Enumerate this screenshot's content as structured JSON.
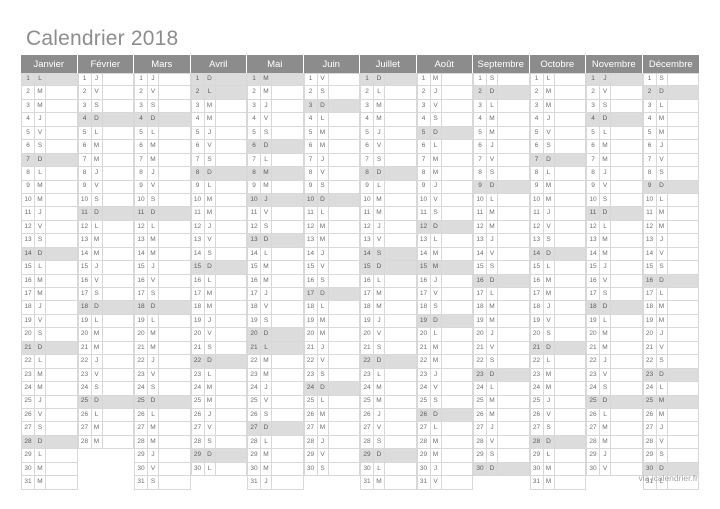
{
  "page": {
    "title": "Calendrier 2018",
    "footer": "via icalendrier.fr",
    "year": 2018,
    "language": "fr"
  },
  "colors": {
    "header_background": "#8c8c8c",
    "header_text": "#ffffff",
    "title_text": "#8d8d8d",
    "grid_line": "#d8d8d8",
    "cell_text": "#6f6f6f",
    "holiday_background": "#dcdcdc",
    "page_background": "#ffffff",
    "footer_text": "#a3a3a3"
  },
  "weekday_letters": {
    "L": "Lundi",
    "M": "Mardi/Mercredi",
    "J": "Jeudi",
    "V": "Vendredi",
    "S": "Samedi",
    "D": "Dimanche"
  },
  "months": [
    {
      "name": "Janvier",
      "index": 1,
      "num_days": 31,
      "start_letter": "L",
      "letters": [
        "L",
        "M",
        "M",
        "J",
        "V",
        "S",
        "D",
        "L",
        "M",
        "M",
        "J",
        "V",
        "S",
        "D",
        "L",
        "M",
        "M",
        "J",
        "V",
        "S",
        "D",
        "L",
        "M",
        "M",
        "J",
        "V",
        "S",
        "D",
        "L",
        "M",
        "M"
      ],
      "off_days": [
        1,
        7,
        14,
        21,
        28
      ]
    },
    {
      "name": "Février",
      "index": 2,
      "num_days": 28,
      "start_letter": "J",
      "letters": [
        "J",
        "V",
        "S",
        "D",
        "L",
        "M",
        "M",
        "J",
        "V",
        "S",
        "D",
        "L",
        "M",
        "M",
        "J",
        "V",
        "S",
        "D",
        "L",
        "M",
        "M",
        "J",
        "V",
        "S",
        "D",
        "L",
        "M",
        "M"
      ],
      "off_days": [
        4,
        11,
        18,
        25
      ]
    },
    {
      "name": "Mars",
      "index": 3,
      "num_days": 31,
      "start_letter": "J",
      "letters": [
        "J",
        "V",
        "S",
        "D",
        "L",
        "M",
        "M",
        "J",
        "V",
        "S",
        "D",
        "L",
        "M",
        "M",
        "J",
        "V",
        "S",
        "D",
        "L",
        "M",
        "M",
        "J",
        "V",
        "S",
        "D",
        "L",
        "M",
        "M",
        "J",
        "V",
        "S"
      ],
      "off_days": [
        4,
        11,
        18,
        25
      ]
    },
    {
      "name": "Avril",
      "index": 4,
      "num_days": 30,
      "start_letter": "D",
      "letters": [
        "D",
        "L",
        "M",
        "M",
        "J",
        "V",
        "S",
        "D",
        "L",
        "M",
        "M",
        "J",
        "V",
        "S",
        "D",
        "L",
        "M",
        "M",
        "J",
        "V",
        "S",
        "D",
        "L",
        "M",
        "M",
        "J",
        "V",
        "S",
        "D",
        "L"
      ],
      "off_days": [
        1,
        2,
        8,
        15,
        22,
        29
      ]
    },
    {
      "name": "Mai",
      "index": 5,
      "num_days": 31,
      "start_letter": "M",
      "letters": [
        "M",
        "M",
        "J",
        "V",
        "S",
        "D",
        "L",
        "M",
        "M",
        "J",
        "V",
        "S",
        "D",
        "L",
        "M",
        "M",
        "J",
        "V",
        "S",
        "D",
        "L",
        "M",
        "M",
        "J",
        "V",
        "S",
        "D",
        "L",
        "M",
        "M",
        "J"
      ],
      "off_days": [
        1,
        6,
        8,
        10,
        13,
        20,
        21,
        27
      ]
    },
    {
      "name": "Juin",
      "index": 6,
      "num_days": 30,
      "start_letter": "V",
      "letters": [
        "V",
        "S",
        "D",
        "L",
        "M",
        "M",
        "J",
        "V",
        "S",
        "D",
        "L",
        "M",
        "M",
        "J",
        "V",
        "S",
        "D",
        "L",
        "M",
        "M",
        "J",
        "V",
        "S",
        "D",
        "L",
        "M",
        "M",
        "J",
        "V",
        "S"
      ],
      "off_days": [
        3,
        10,
        17,
        24
      ]
    },
    {
      "name": "Juillet",
      "index": 7,
      "num_days": 31,
      "start_letter": "D",
      "letters": [
        "D",
        "L",
        "M",
        "M",
        "J",
        "V",
        "S",
        "D",
        "L",
        "M",
        "M",
        "J",
        "V",
        "S",
        "D",
        "L",
        "M",
        "M",
        "J",
        "V",
        "S",
        "D",
        "L",
        "M",
        "M",
        "J",
        "V",
        "S",
        "D",
        "L",
        "M"
      ],
      "off_days": [
        1,
        8,
        14,
        15,
        22,
        29
      ]
    },
    {
      "name": "Août",
      "index": 8,
      "num_days": 31,
      "start_letter": "M",
      "letters": [
        "M",
        "J",
        "V",
        "S",
        "D",
        "L",
        "M",
        "M",
        "J",
        "V",
        "S",
        "D",
        "L",
        "M",
        "M",
        "J",
        "V",
        "S",
        "D",
        "L",
        "M",
        "M",
        "J",
        "V",
        "S",
        "D",
        "L",
        "M",
        "M",
        "J",
        "V"
      ],
      "off_days": [
        5,
        12,
        15,
        19,
        26
      ]
    },
    {
      "name": "Septembre",
      "index": 9,
      "num_days": 30,
      "start_letter": "S",
      "letters": [
        "S",
        "D",
        "L",
        "M",
        "M",
        "J",
        "V",
        "S",
        "D",
        "L",
        "M",
        "M",
        "J",
        "V",
        "S",
        "D",
        "L",
        "M",
        "M",
        "J",
        "V",
        "S",
        "D",
        "L",
        "M",
        "M",
        "J",
        "V",
        "S",
        "D"
      ],
      "off_days": [
        2,
        9,
        16,
        23,
        30
      ]
    },
    {
      "name": "Octobre",
      "index": 10,
      "num_days": 31,
      "start_letter": "L",
      "letters": [
        "L",
        "M",
        "M",
        "J",
        "V",
        "S",
        "D",
        "L",
        "M",
        "M",
        "J",
        "V",
        "S",
        "D",
        "L",
        "M",
        "M",
        "J",
        "V",
        "S",
        "D",
        "L",
        "M",
        "M",
        "J",
        "V",
        "S",
        "D",
        "L",
        "M",
        "M"
      ],
      "off_days": [
        7,
        14,
        21,
        28
      ]
    },
    {
      "name": "Novembre",
      "index": 11,
      "num_days": 30,
      "start_letter": "J",
      "letters": [
        "J",
        "V",
        "S",
        "D",
        "L",
        "M",
        "M",
        "J",
        "V",
        "S",
        "D",
        "L",
        "M",
        "M",
        "J",
        "V",
        "S",
        "D",
        "L",
        "M",
        "M",
        "J",
        "V",
        "S",
        "D",
        "L",
        "M",
        "M",
        "J",
        "V"
      ],
      "off_days": [
        1,
        4,
        11,
        18,
        25
      ]
    },
    {
      "name": "Décembre",
      "index": 12,
      "num_days": 31,
      "start_letter": "S",
      "letters": [
        "S",
        "D",
        "L",
        "M",
        "M",
        "J",
        "V",
        "S",
        "D",
        "L",
        "M",
        "M",
        "J",
        "V",
        "S",
        "D",
        "L",
        "M",
        "M",
        "J",
        "V",
        "S",
        "D",
        "L",
        "M",
        "M",
        "J",
        "V",
        "S",
        "D",
        "L"
      ],
      "off_days": [
        2,
        9,
        16,
        23,
        25,
        30
      ]
    }
  ]
}
